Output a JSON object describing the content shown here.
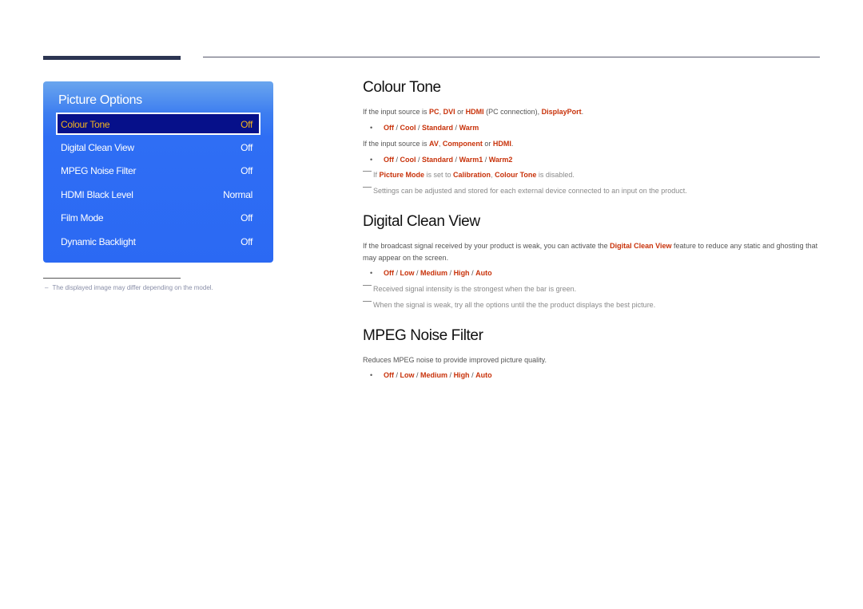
{
  "menu": {
    "title": "Picture Options",
    "items": [
      {
        "label": "Colour Tone",
        "value": "Off",
        "selected": true
      },
      {
        "label": "Digital Clean View",
        "value": "Off"
      },
      {
        "label": "MPEG Noise Filter",
        "value": "Off"
      },
      {
        "label": "HDMI Black Level",
        "value": "Normal"
      },
      {
        "label": "Film Mode",
        "value": "Off"
      },
      {
        "label": "Dynamic Backlight",
        "value": "Off"
      }
    ],
    "colors": {
      "panel": "#2b69f3",
      "selected_bg": "#06108a",
      "selected_text": "#f2b21e"
    }
  },
  "footnote": {
    "dash": "–",
    "text": "The displayed image may differ depending on the model."
  },
  "accent_color": "#c8320a",
  "sections": {
    "colour_tone": {
      "title": "Colour Tone",
      "line1": {
        "t1": "If the input source is ",
        "k1": "PC",
        "t2": ", ",
        "k2": "DVI",
        "t3": " or ",
        "k3": "HDMI",
        "t4": " (PC connection), ",
        "k4": "DisplayPort",
        "t5": "."
      },
      "options1": [
        "Off",
        "Cool",
        "Standard",
        "Warm"
      ],
      "line2": {
        "t1": "If the input source is ",
        "k1": "AV",
        "t2": ", ",
        "k2": "Component",
        "t3": " or ",
        "k3": "HDMI",
        "t4": "."
      },
      "options2": [
        "Off",
        "Cool",
        "Standard",
        "Warm1",
        "Warm2"
      ],
      "note1": {
        "t1": "If ",
        "k1": "Picture Mode",
        "t2": " is set to ",
        "k2": "Calibration",
        "t3": ", ",
        "k3": "Colour Tone",
        "t4": " is disabled."
      },
      "note2": "Settings can be adjusted and stored for each external device connected to an input on the product."
    },
    "digital_clean_view": {
      "title": "Digital Clean View",
      "desc": {
        "t1": "If the broadcast signal received by your product is weak, you can activate the ",
        "k1": "Digital Clean View",
        "t2": " feature to reduce any static and ghosting that may appear on the screen."
      },
      "options": [
        "Off",
        "Low",
        "Medium",
        "High",
        "Auto"
      ],
      "note1": "Received signal intensity is the strongest when the bar is green.",
      "note2": "When the signal is weak, try all the options until the the product displays the best picture."
    },
    "mpeg_noise_filter": {
      "title": "MPEG Noise Filter",
      "desc": "Reduces MPEG noise to provide improved picture quality.",
      "options": [
        "Off",
        "Low",
        "Medium",
        "High",
        "Auto"
      ]
    }
  },
  "separator": " / ",
  "bullet": "•"
}
